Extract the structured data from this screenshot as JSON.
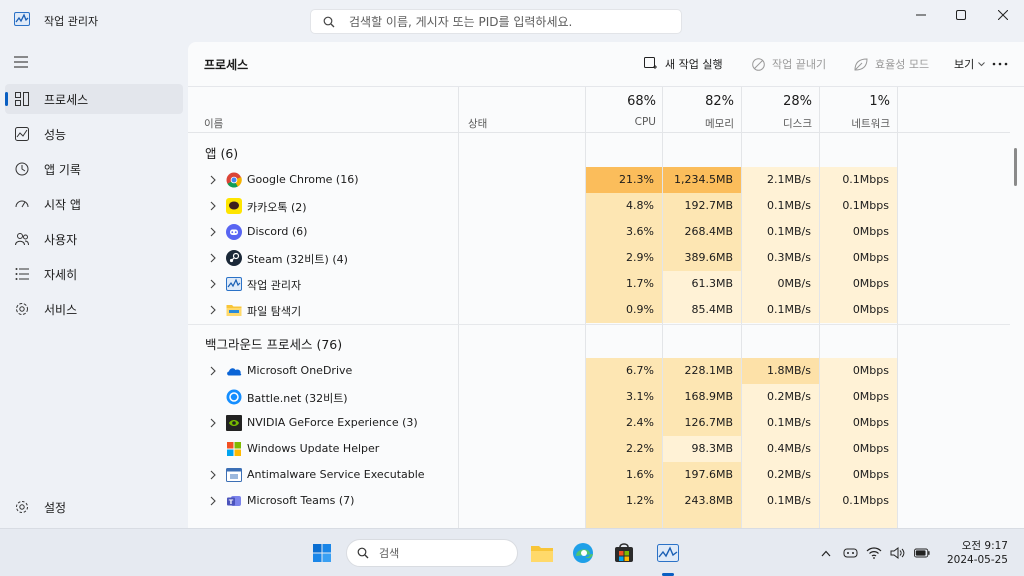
{
  "window": {
    "title": "작업 관리자",
    "search_placeholder": "검색할 이름, 게시자 또는 PID를 입력하세요."
  },
  "sidebar": {
    "items": [
      {
        "label": "프로세스",
        "icon": "processes-icon",
        "active": true
      },
      {
        "label": "성능",
        "icon": "performance-icon"
      },
      {
        "label": "앱 기록",
        "icon": "app-history-icon"
      },
      {
        "label": "시작 앱",
        "icon": "startup-apps-icon"
      },
      {
        "label": "사용자",
        "icon": "users-icon"
      },
      {
        "label": "자세히",
        "icon": "details-icon"
      },
      {
        "label": "서비스",
        "icon": "services-icon"
      }
    ],
    "settings_label": "설정"
  },
  "main": {
    "title": "프로세스",
    "toolbar": {
      "run_new_task": "새 작업 실행",
      "end_task": "작업 끝내기",
      "efficiency_mode": "효율성 모드",
      "view": "보기"
    },
    "columns": {
      "name": "이름",
      "status": "상태",
      "cpu": {
        "pct": "68%",
        "label": "CPU"
      },
      "memory": {
        "pct": "82%",
        "label": "메모리"
      },
      "disk": {
        "pct": "28%",
        "label": "디스크"
      },
      "network": {
        "pct": "1%",
        "label": "네트워크"
      }
    },
    "groups": [
      {
        "title": "앱 (6)",
        "rows": [
          {
            "name": "Google Chrome (16)",
            "icon": "chrome-icon",
            "expandable": true,
            "cpu": "21.3%",
            "mem": "1,234.5MB",
            "disk": "2.1MB/s",
            "net": "0.1Mbps"
          },
          {
            "name": "카카오톡 (2)",
            "icon": "kakaotalk-icon",
            "expandable": true,
            "cpu": "4.8%",
            "mem": "192.7MB",
            "disk": "0.1MB/s",
            "net": "0.1Mbps"
          },
          {
            "name": "Discord (6)",
            "icon": "discord-icon",
            "expandable": true,
            "cpu": "3.6%",
            "mem": "268.4MB",
            "disk": "0.1MB/s",
            "net": "0Mbps"
          },
          {
            "name": "Steam (32비트) (4)",
            "icon": "steam-icon",
            "expandable": true,
            "cpu": "2.9%",
            "mem": "389.6MB",
            "disk": "0.3MB/s",
            "net": "0Mbps"
          },
          {
            "name": "작업 관리자",
            "icon": "task-manager-icon",
            "expandable": true,
            "cpu": "1.7%",
            "mem": "61.3MB",
            "disk": "0MB/s",
            "net": "0Mbps"
          },
          {
            "name": "파일 탐색기",
            "icon": "file-explorer-icon",
            "expandable": true,
            "cpu": "0.9%",
            "mem": "85.4MB",
            "disk": "0.1MB/s",
            "net": "0Mbps"
          }
        ]
      },
      {
        "title": "백그라운드 프로세스 (76)",
        "rows": [
          {
            "name": "Microsoft OneDrive",
            "icon": "onedrive-icon",
            "expandable": true,
            "cpu": "6.7%",
            "mem": "228.1MB",
            "disk": "1.8MB/s",
            "net": "0Mbps"
          },
          {
            "name": "Battle.net (32비트)",
            "icon": "battlenet-icon",
            "expandable": false,
            "cpu": "3.1%",
            "mem": "168.9MB",
            "disk": "0.2MB/s",
            "net": "0Mbps"
          },
          {
            "name": "NVIDIA GeForce Experience (3)",
            "icon": "nvidia-icon",
            "expandable": true,
            "cpu": "2.4%",
            "mem": "126.7MB",
            "disk": "0.1MB/s",
            "net": "0Mbps"
          },
          {
            "name": "Windows Update Helper",
            "icon": "windows-update-icon",
            "expandable": false,
            "cpu": "2.2%",
            "mem": "98.3MB",
            "disk": "0.4MB/s",
            "net": "0Mbps"
          },
          {
            "name": "Antimalware Service Executable",
            "icon": "antimalware-icon",
            "expandable": true,
            "cpu": "1.6%",
            "mem": "197.6MB",
            "disk": "0.2MB/s",
            "net": "0Mbps"
          },
          {
            "name": "Microsoft Teams (7)",
            "icon": "teams-icon",
            "expandable": true,
            "cpu": "1.2%",
            "mem": "243.8MB",
            "disk": "0.1MB/s",
            "net": "0.1Mbps"
          }
        ]
      }
    ]
  },
  "taskbar": {
    "search_label": "검색",
    "time": "오전 9:17",
    "date": "2024-05-25"
  },
  "colors": {
    "heat_high": "#fbbd5b",
    "heat_mid": "#fde6b3",
    "heat_low": "#fff2d6",
    "accent": "#0a5fc2"
  }
}
